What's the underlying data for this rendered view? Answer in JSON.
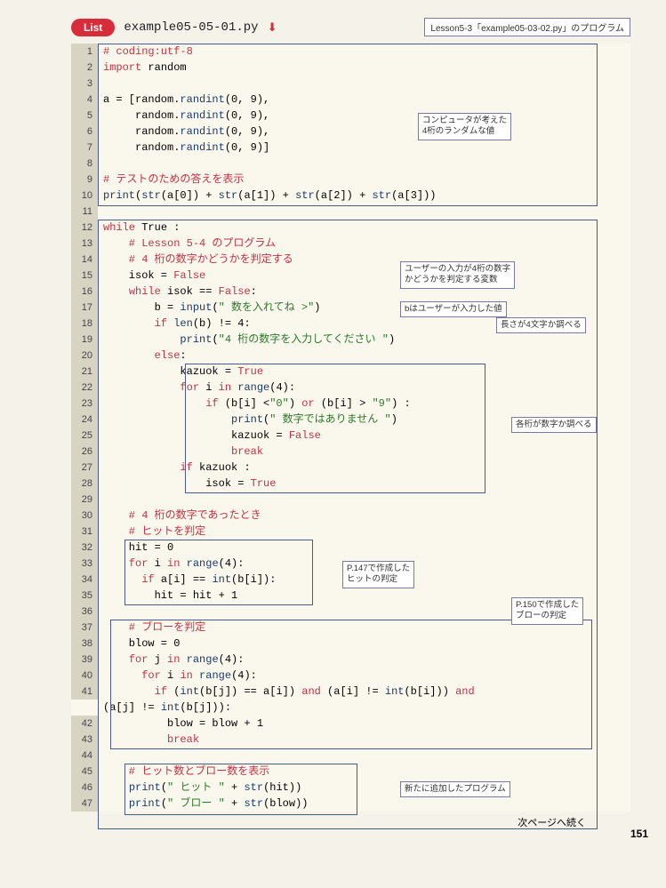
{
  "header": {
    "badge": "List",
    "filename": "example05-05-01.py",
    "download_icon": "⬇",
    "reference": "Lesson5-3「example05-03-02.py」のプログラム"
  },
  "notes": {
    "n1": "コンピュータが考えた\n4桁のランダムな値",
    "n2": "ユーザーの入力が4桁の数字\nかどうかを判定する変数",
    "n3": "bはユーザーが入力した値",
    "n4": "長さが4文字か調べる",
    "n5": "各桁が数字か調べる",
    "n6": "P.147で作成した\nヒットの判定",
    "n7": "P.150で作成した\nブローの判定",
    "n8": "新たに追加したプログラム"
  },
  "code": {
    "l1": "# coding:utf-8",
    "l2a": "import",
    "l2b": " random",
    "l4a": "a = [random.",
    "l4b": "randint",
    "l4c": "(0, 9),",
    "l5a": "     random.",
    "l5b": "randint",
    "l5c": "(0, 9),",
    "l6a": "     random.",
    "l6b": "randint",
    "l6c": "(0, 9),",
    "l7a": "     random.",
    "l7b": "randint",
    "l7c": "(0, 9)]",
    "l9": "# テストのための答えを表示",
    "l10a": "print",
    "l10b": "(",
    "l10c": "str",
    "l10d": "(a[0]) + ",
    "l10e": "str",
    "l10f": "(a[1]) + ",
    "l10g": "str",
    "l10h": "(a[2]) + ",
    "l10i": "str",
    "l10j": "(a[3]))",
    "l12a": "while",
    "l12b": " True :",
    "l13": "    # Lesson 5-4 のプログラム",
    "l14": "    # 4 桁の数字かどうかを判定する",
    "l15a": "    isok = ",
    "l15b": "False",
    "l16a": "    ",
    "l16b": "while",
    "l16c": " isok == ",
    "l16d": "False",
    "l16e": ":",
    "l17a": "        b = ",
    "l17b": "input",
    "l17c": "(",
    "l17d": "\" 数を入れてね >\"",
    "l17e": ")",
    "l18a": "        ",
    "l18b": "if",
    "l18c": " ",
    "l18d": "len",
    "l18e": "(b) != 4:",
    "l19a": "            ",
    "l19b": "print",
    "l19c": "(",
    "l19d": "\"4 桁の数字を入力してください \"",
    "l19e": ")",
    "l20a": "        ",
    "l20b": "else",
    "l20c": ":",
    "l21a": "            kazuok = ",
    "l21b": "True",
    "l22a": "            ",
    "l22b": "for",
    "l22c": " i ",
    "l22d": "in",
    "l22e": " ",
    "l22f": "range",
    "l22g": "(4):",
    "l23a": "                ",
    "l23b": "if",
    "l23c": " (b[i] <",
    "l23d": "\"0\"",
    "l23e": ") ",
    "l23f": "or",
    "l23g": " (b[i] > ",
    "l23h": "\"9\"",
    "l23i": ") :",
    "l24a": "                    ",
    "l24b": "print",
    "l24c": "(",
    "l24d": "\" 数字ではありません \"",
    "l24e": ")",
    "l25a": "                    kazuok = ",
    "l25b": "False",
    "l26a": "                    ",
    "l26b": "break",
    "l27a": "            ",
    "l27b": "if",
    "l27c": " kazuok :",
    "l28a": "                isok = ",
    "l28b": "True",
    "l30": "    # 4 桁の数字であったとき",
    "l31": "    # ヒットを判定",
    "l32": "    hit = 0",
    "l33a": "    ",
    "l33b": "for",
    "l33c": " i ",
    "l33d": "in",
    "l33e": " ",
    "l33f": "range",
    "l33g": "(4):",
    "l34a": "      ",
    "l34b": "if",
    "l34c": " a[i] == ",
    "l34d": "int",
    "l34e": "(b[i]):",
    "l35": "        hit = hit + 1",
    "l37": "    # ブローを判定",
    "l38": "    blow = 0",
    "l39a": "    ",
    "l39b": "for",
    "l39c": " j ",
    "l39d": "in",
    "l39e": " ",
    "l39f": "range",
    "l39g": "(4):",
    "l40a": "      ",
    "l40b": "for",
    "l40c": " i ",
    "l40d": "in",
    "l40e": " ",
    "l40f": "range",
    "l40g": "(4):",
    "l41a": "        ",
    "l41b": "if",
    "l41c": " (",
    "l41d": "int",
    "l41e": "(b[j]) == a[i]) ",
    "l41f": "and",
    "l41g": " (a[i] != ",
    "l41h": "int",
    "l41i": "(b[i])) ",
    "l41j": "and",
    "l41x": "(a[j] != ",
    "l41y": "int",
    "l41z": "(b[j])):",
    "l42": "          blow = blow + 1",
    "l43a": "          ",
    "l43b": "break",
    "l45": "    # ヒット数とブロー数を表示",
    "l46a": "    ",
    "l46b": "print",
    "l46c": "(",
    "l46d": "\" ヒット \"",
    "l46e": " + ",
    "l46f": "str",
    "l46g": "(hit))",
    "l47a": "    ",
    "l47b": "print",
    "l47c": "(",
    "l47d": "\" ブロー \"",
    "l47e": " + ",
    "l47f": "str",
    "l47g": "(blow))"
  },
  "footer": {
    "continue": "次ページへ続く",
    "page": "151"
  }
}
